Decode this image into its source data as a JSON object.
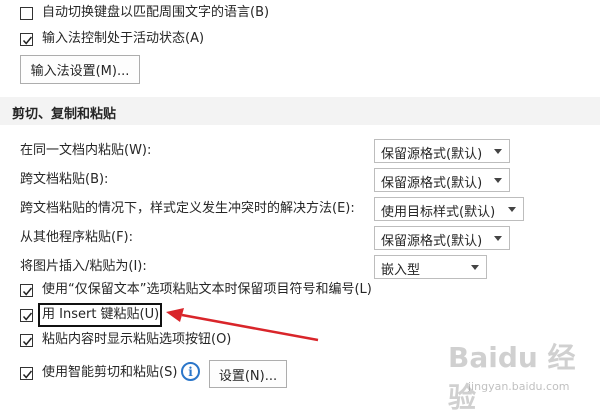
{
  "options_top": [
    {
      "label": "自动切换键盘以匹配周围文字的语言(B)",
      "checked": false
    },
    {
      "label": "输入法控制处于活动状态(A)",
      "checked": true
    }
  ],
  "ime_settings_button": "输入法设置(M)...",
  "section_title": "剪切、复制和粘贴",
  "paste_rows": [
    {
      "label": "在同一文档内粘贴(W):",
      "value": "保留源格式(默认)"
    },
    {
      "label": "跨文档粘贴(B):",
      "value": "保留源格式(默认)"
    },
    {
      "label": "跨文档粘贴的情况下，样式定义发生冲突时的解决方法(E):",
      "value": "使用目标样式(默认)"
    },
    {
      "label": "从其他程序粘贴(F):",
      "value": "保留源格式(默认)"
    },
    {
      "label": "将图片插入/粘贴为(I):",
      "value": "嵌入型"
    }
  ],
  "options_bottom": [
    {
      "label": "使用“仅保留文本”选项粘贴文本时保留项目符号和编号(L)",
      "checked": true
    },
    {
      "label": "用 Insert 键粘贴(U)",
      "checked": true
    },
    {
      "label": "粘贴内容时显示粘贴选项按钮(O)",
      "checked": true
    },
    {
      "label": "使用智能剪切和粘贴(S)",
      "checked": true
    }
  ],
  "smart_settings_button": "设置(N)...",
  "info_icon": "i",
  "annotation_color": "#d9252a",
  "watermark": {
    "main": "Baidu 经验",
    "sub": "jingyan.baidu.com"
  }
}
